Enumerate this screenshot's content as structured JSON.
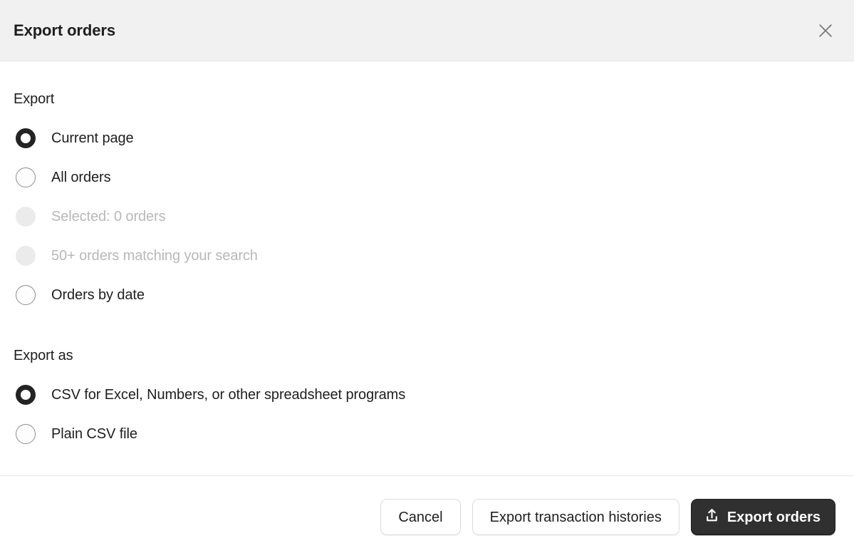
{
  "header": {
    "title": "Export orders",
    "close_icon": "close-icon"
  },
  "sections": [
    {
      "heading": "Export",
      "options": [
        {
          "label": "Current page",
          "state": "checked"
        },
        {
          "label": "All orders",
          "state": "unchecked"
        },
        {
          "label": "Selected: 0 orders",
          "state": "disabled"
        },
        {
          "label": "50+ orders matching your search",
          "state": "disabled"
        },
        {
          "label": "Orders by date",
          "state": "unchecked"
        }
      ]
    },
    {
      "heading": "Export as",
      "options": [
        {
          "label": "CSV for Excel, Numbers, or other spreadsheet programs",
          "state": "checked"
        },
        {
          "label": "Plain CSV file",
          "state": "unchecked"
        }
      ]
    }
  ],
  "footer": {
    "cancel_label": "Cancel",
    "export_transactions_label": "Export transaction histories",
    "export_orders_label": "Export orders",
    "export_icon": "upload-export-icon"
  },
  "colors": {
    "header_bg": "#f1f1f1",
    "divider": "#e3e3e3",
    "text": "#1e1e1e",
    "text_disabled": "#b8b8b8",
    "radio_border": "#8d8d8d",
    "radio_disabled_fill": "#ebebeb",
    "primary_bg": "#303030",
    "primary_text": "#ffffff",
    "secondary_border": "#dcdcdc"
  }
}
